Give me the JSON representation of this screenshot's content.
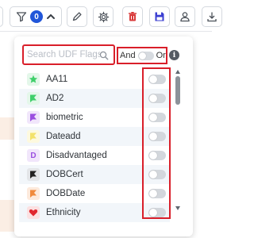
{
  "toolbar": {
    "filter_badge_count": "0",
    "icons": [
      "filter-icon",
      "chevron-up-icon",
      "pencil-icon",
      "gear-icon",
      "trash-icon",
      "save-icon",
      "user-icon",
      "download-icon"
    ],
    "colors": {
      "badge": "#2156d9",
      "trash": "#d93a3a",
      "save": "#3b3fd1"
    }
  },
  "search": {
    "placeholder": "Search UDF Flags",
    "value": ""
  },
  "logic_toggle": {
    "left_label": "And",
    "right_label": "Or",
    "info_icon": "i"
  },
  "flags": [
    {
      "label": "AA11",
      "icon": "star-icon",
      "color": "#3fcf6a",
      "enabled": false
    },
    {
      "label": "AD2",
      "icon": "flag-icon",
      "color": "#3fcf6a",
      "enabled": false
    },
    {
      "label": "biometric",
      "icon": "flag-icon",
      "color": "#9b4fe0",
      "enabled": false
    },
    {
      "label": "Dateadd",
      "icon": "flag-icon",
      "color": "#f3e26a",
      "enabled": false
    },
    {
      "label": "Disadvantaged",
      "icon": "letter-d-icon",
      "color": "#9b4fe0",
      "glyph": "D",
      "enabled": false
    },
    {
      "label": "DOBCert",
      "icon": "flag-icon",
      "color": "#222222",
      "enabled": false
    },
    {
      "label": "DOBDate",
      "icon": "flag-icon",
      "color": "#f08a3c",
      "enabled": false
    },
    {
      "label": "Ethnicity",
      "icon": "heart-icon",
      "color": "#e0262e",
      "enabled": false
    }
  ]
}
